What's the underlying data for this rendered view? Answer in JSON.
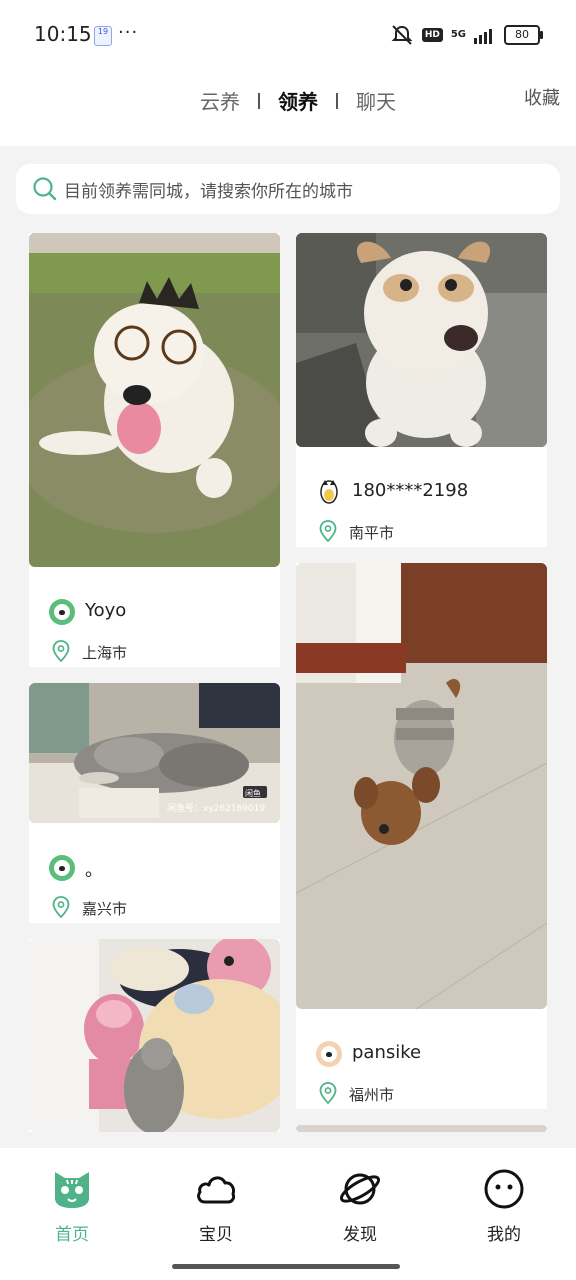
{
  "status_bar": {
    "time": "10:15",
    "notif_badge": "19",
    "more": "···",
    "hd": "HD",
    "net": "5G",
    "battery": "80"
  },
  "header": {
    "tabs": [
      {
        "label": "云养",
        "active": false
      },
      {
        "label": "领养",
        "active": true
      },
      {
        "label": "聊天",
        "active": false
      }
    ],
    "favorites": "收藏"
  },
  "search": {
    "placeholder": "目前领养需同城，请搜索你所在的城市"
  },
  "cards": [
    {
      "user": "Yoyo",
      "city": "上海市"
    },
    {
      "user": "180****2198",
      "city": "南平市"
    },
    {
      "user": "。",
      "city": "嘉兴市"
    },
    {
      "user": "pansike",
      "city": "福州市"
    }
  ],
  "photo_watermark": "闲鱼号：xy262169019",
  "tabbar": {
    "items": [
      {
        "label": "首页",
        "icon": "cat-face-icon",
        "active": true
      },
      {
        "label": "宝贝",
        "icon": "cloud-icon",
        "active": false
      },
      {
        "label": "发现",
        "icon": "planet-icon",
        "active": false
      },
      {
        "label": "我的",
        "icon": "smiley-icon",
        "active": false
      }
    ]
  },
  "colors": {
    "accent": "#4fb38a",
    "background": "#f3f3f3"
  }
}
